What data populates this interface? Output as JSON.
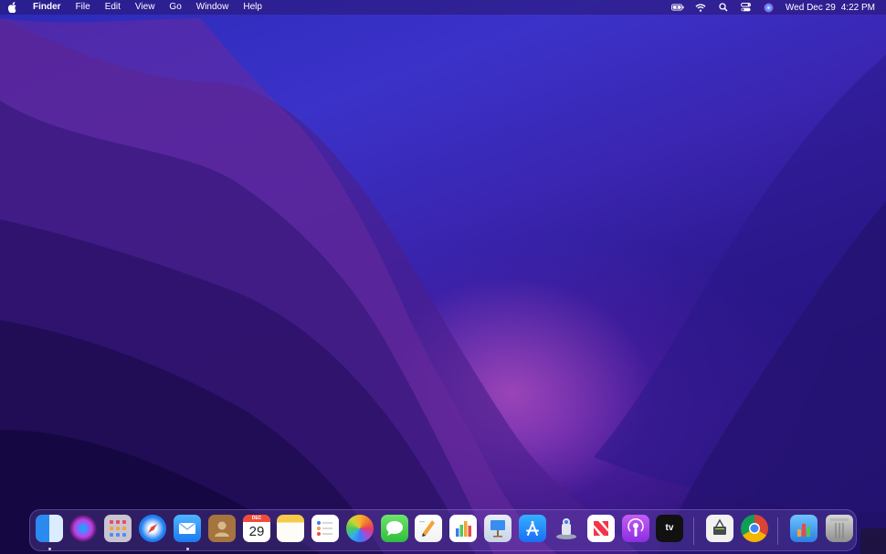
{
  "menubar": {
    "apple_icon": "apple-logo-icon",
    "items": [
      "Finder",
      "File",
      "Edit",
      "View",
      "Go",
      "Window",
      "Help"
    ],
    "status_icons": [
      "battery-charging-icon",
      "wifi-icon",
      "spotlight-search-icon",
      "control-center-icon",
      "siri-icon"
    ],
    "date": "Wed Dec 29",
    "time": "4:22 PM"
  },
  "dock": {
    "apps": [
      {
        "icon": "finder-icon",
        "running": true
      },
      {
        "icon": "siri-icon",
        "running": false
      },
      {
        "icon": "launchpad-icon",
        "running": false
      },
      {
        "icon": "safari-icon",
        "running": false
      },
      {
        "icon": "mail-icon",
        "running": true
      },
      {
        "icon": "contacts-icon",
        "running": false
      },
      {
        "icon": "calendar-icon",
        "running": false,
        "month": "DEC",
        "day": "29"
      },
      {
        "icon": "notes-icon",
        "running": false
      },
      {
        "icon": "reminders-icon",
        "running": false
      },
      {
        "icon": "photos-icon",
        "running": false
      },
      {
        "icon": "messages-icon",
        "running": false
      },
      {
        "icon": "pages-icon",
        "running": false
      },
      {
        "icon": "numbers-icon",
        "running": false
      },
      {
        "icon": "keynote-icon",
        "running": false
      },
      {
        "icon": "app-store-icon",
        "running": false
      },
      {
        "icon": "transporter-icon",
        "running": false
      },
      {
        "icon": "news-icon",
        "running": false
      },
      {
        "icon": "podcasts-icon",
        "running": false
      },
      {
        "icon": "apple-tv-icon",
        "running": false,
        "label": "tv"
      },
      {
        "icon": "system-information-icon",
        "running": false
      },
      {
        "icon": "chrome-icon",
        "running": false
      },
      {
        "icon": "applications-folder-icon",
        "running": false
      },
      {
        "icon": "trash-icon",
        "running": false
      }
    ]
  },
  "colors": {
    "menubar_text": "#ffffff",
    "wallpaper_top": "#3b32c9",
    "wallpaper_bottom": "#1a0d5a",
    "wallpaper_glow": "#dc64c8"
  }
}
